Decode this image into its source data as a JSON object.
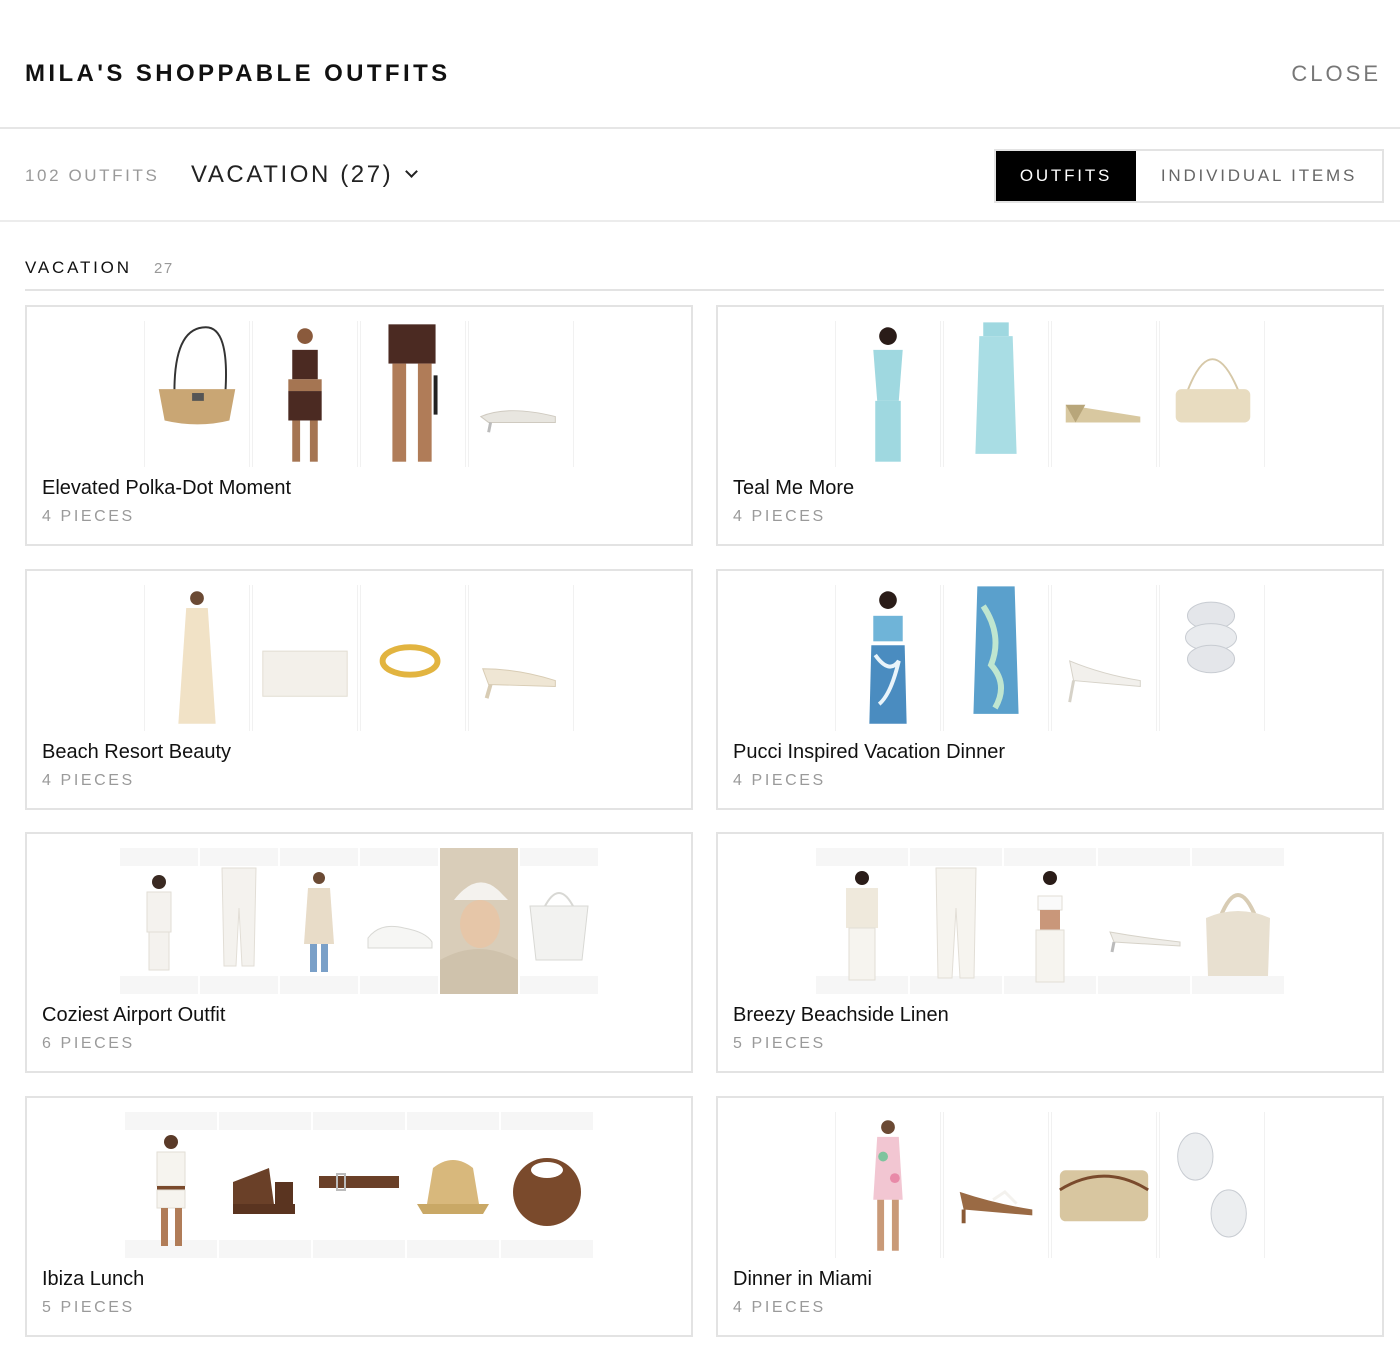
{
  "header": {
    "title": "MILA'S SHOPPABLE OUTFITS",
    "close_label": "CLOSE"
  },
  "filters": {
    "count_label": "102 OUTFITS",
    "dropdown_label": "VACATION (27)",
    "toggle": {
      "active": "OUTFITS",
      "inactive": "INDIVIDUAL ITEMS"
    }
  },
  "section": {
    "title": "VACATION",
    "count": "27"
  },
  "outfits": [
    {
      "name": "Elevated Polka-Dot Moment",
      "pieces": "4 PIECES",
      "items": [
        "woven-shoulder-bag",
        "polka-dot-halter-set-model",
        "polka-dot-shorts-model",
        "white-kitten-heel-sandal"
      ]
    },
    {
      "name": "Teal Me More",
      "pieces": "4 PIECES",
      "items": [
        "teal-halter-top-model",
        "teal-maxi-skirt-model",
        "gold-wedge-sandal",
        "metallic-mesh-bag"
      ]
    },
    {
      "name": "Beach Resort Beauty",
      "pieces": "4 PIECES",
      "items": [
        "cream-maxi-dress-model",
        "white-clutch",
        "gold-cuff-bracelet",
        "cream-mule-heel"
      ]
    },
    {
      "name": "Pucci Inspired Vacation Dinner",
      "pieces": "4 PIECES",
      "items": [
        "printed-bandeau-model",
        "printed-maxi-skirt-model",
        "white-thong-heel",
        "silver-cuff-bangles"
      ]
    },
    {
      "name": "Coziest Airport Outfit",
      "pieces": "6 PIECES",
      "items": [
        "white-polo-model",
        "white-joggers-model",
        "trench-coat-model",
        "white-sneaker",
        "white-cap-model",
        "white-tote"
      ]
    },
    {
      "name": "Breezy Beachside Linen",
      "pieces": "5 PIECES",
      "items": [
        "crochet-top-model",
        "white-linen-pants-model",
        "white-bandeau-model",
        "white-kitten-sandal",
        "cream-hobo-bag"
      ]
    },
    {
      "name": "Ibiza Lunch",
      "pieces": "5 PIECES",
      "items": [
        "white-mini-set-model",
        "brown-platform-sandal",
        "brown-belt",
        "straw-bucket-hat",
        "brown-round-bag"
      ]
    },
    {
      "name": "Dinner in Miami",
      "pieces": "4 PIECES",
      "items": [
        "floral-mini-dress-model",
        "brown-thong-heel",
        "woven-chain-bag",
        "silver-drop-earrings"
      ]
    }
  ],
  "colors": {
    "accent": "#000000",
    "muted_text": "#9a9a9a",
    "border": "#e3e3e3"
  }
}
